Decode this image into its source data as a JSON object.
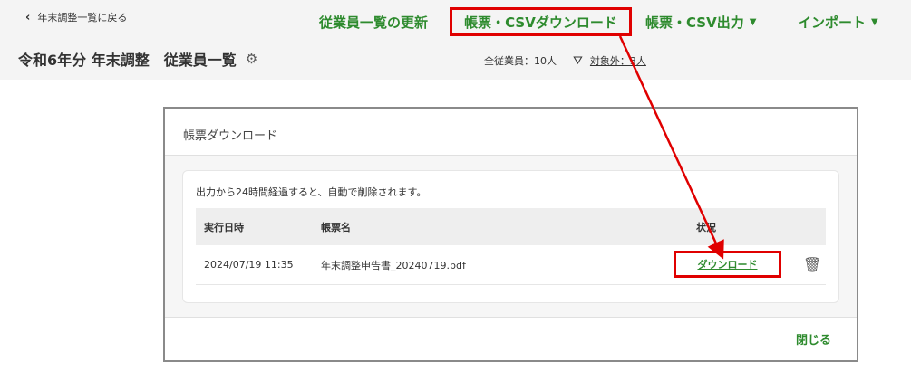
{
  "header": {
    "back_label": "年末調整一覧に戻る",
    "page_title": "令和6年分 年末調整　従業員一覧",
    "nav": {
      "refresh": "従業員一覧の更新",
      "download": "帳票・CSVダウンロード",
      "output": "帳票・CSV出力",
      "import": "インポート"
    },
    "counts": {
      "all": "全従業員：10人",
      "excluded": "対象外：3人"
    }
  },
  "modal": {
    "title": "帳票ダウンロード",
    "notice": "出力から24時間経過すると、自動で削除されます。",
    "columns": {
      "date": "実行日時",
      "name": "帳票名",
      "status": "状況"
    },
    "rows": [
      {
        "date": "2024/07/19 11:35",
        "name": "年末調整申告書_20240719.pdf",
        "status": "ダウンロード"
      }
    ],
    "close_label": "閉じる"
  },
  "colors": {
    "accent_green": "#2e8b2e",
    "highlight_red": "#e00000"
  }
}
